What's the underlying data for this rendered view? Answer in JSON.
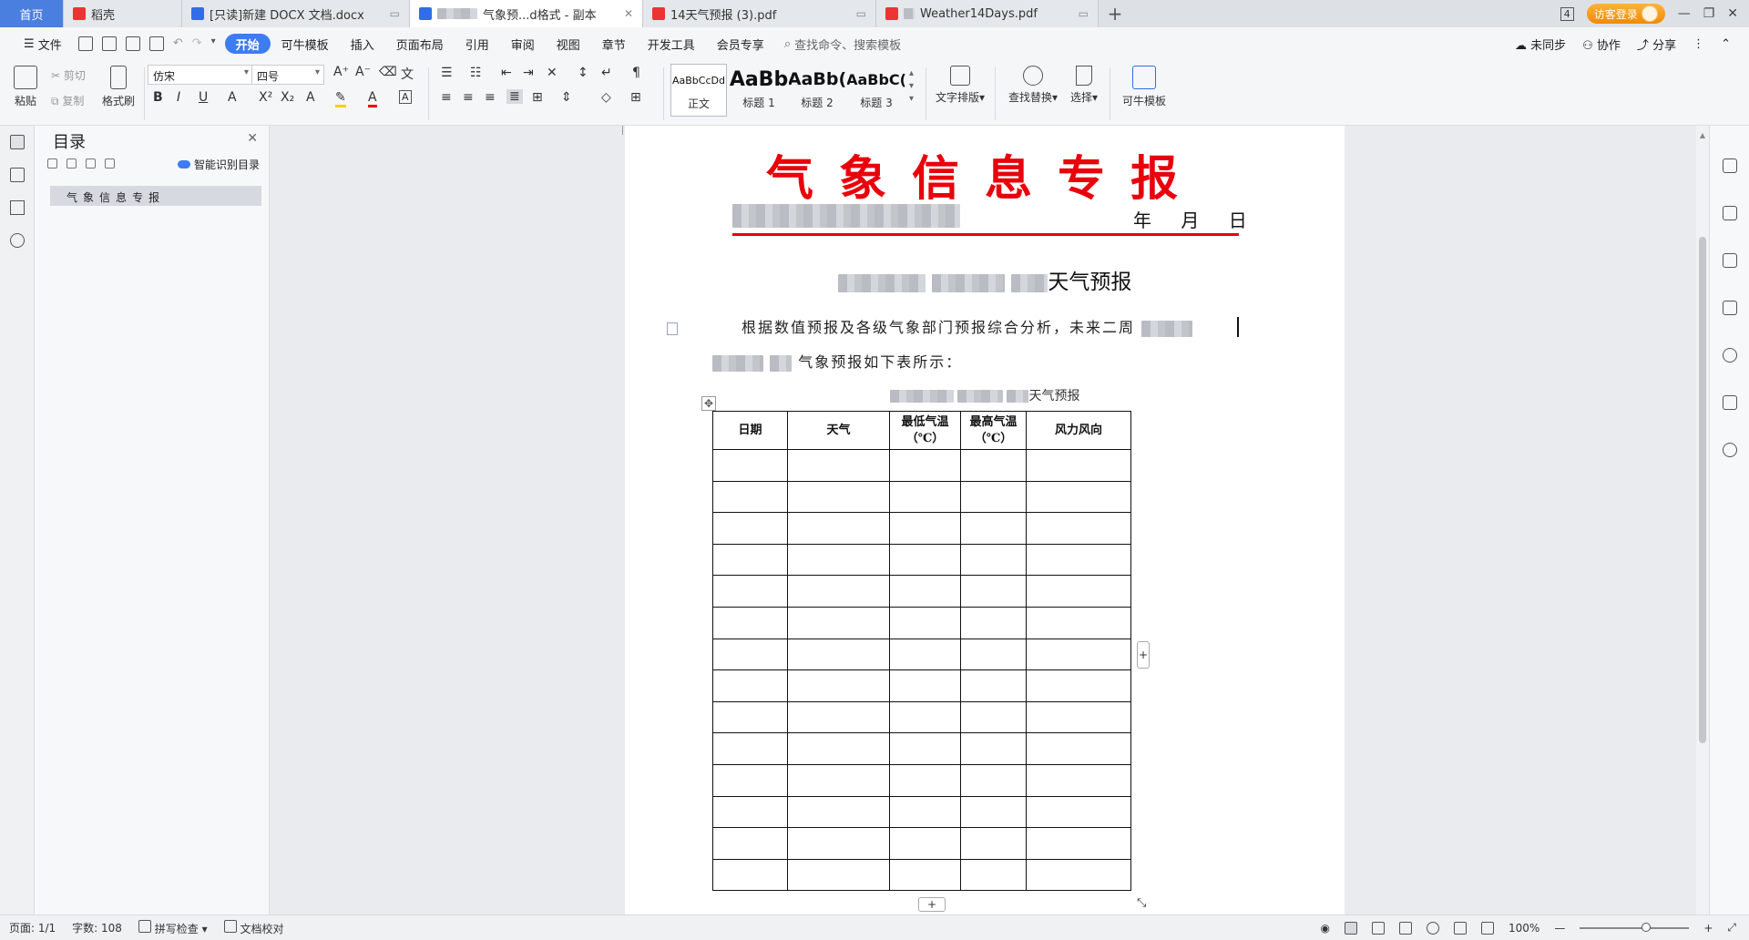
{
  "tabs": [
    {
      "label": "首页",
      "kind": "home"
    },
    {
      "label": "稻壳",
      "icon": "daoke-icon"
    },
    {
      "label": "[只读]新建 DOCX 文档.docx",
      "icon": "wps-writer-icon"
    },
    {
      "label": "气象预...d格式 - 副本",
      "icon": "wps-writer-icon",
      "active": true
    },
    {
      "label": "14天气预报 (3).pdf",
      "icon": "pdf-icon"
    },
    {
      "label": "Weather14Days.pdf",
      "icon": "pdf-icon"
    }
  ],
  "window": {
    "badge": "4",
    "login": "访客登录"
  },
  "menu": {
    "file": "文件",
    "items": [
      "开始",
      "可牛模板",
      "插入",
      "页面布局",
      "引用",
      "审阅",
      "视图",
      "章节",
      "开发工具",
      "会员专享"
    ],
    "active": "开始",
    "search": "查找命令、搜索模板",
    "right": [
      "未同步",
      "协作",
      "分享"
    ]
  },
  "ribbon": {
    "paste": "粘贴",
    "cut": "剪切",
    "copy": "复制",
    "format_painter": "格式刷",
    "font": "仿宋",
    "size": "四号",
    "styles": [
      {
        "sample": "AaBbCcDd",
        "name": "正文"
      },
      {
        "sample": "AaBb",
        "name": "标题 1"
      },
      {
        "sample": "AaBb(",
        "name": "标题 2"
      },
      {
        "sample": "AaBbC(",
        "name": "标题 3"
      }
    ],
    "text_layout": "文字排版",
    "find_replace": "查找替换",
    "select": "选择",
    "template": "可牛模板"
  },
  "toc": {
    "title": "目录",
    "smart": "智能识别目录",
    "entries": [
      "气象信息专报"
    ]
  },
  "doc": {
    "title": "气象信息专报",
    "date": "年 月 日",
    "heading": "天气预报",
    "para1": "根据数值预报及各级气象部门预报综合分析，未来二周",
    "para2": "气象预报如下表所示：",
    "caption": "天气预报",
    "table_headers": [
      "日期",
      "天气",
      "最低气温 （℃）",
      "最高气温 （℃）",
      "风力风向"
    ],
    "row_count": 14
  },
  "status": {
    "page": "页面: 1/1",
    "words": "字数: 108",
    "spell": "拼写检查",
    "proof": "文档校对",
    "zoom": "100%"
  }
}
